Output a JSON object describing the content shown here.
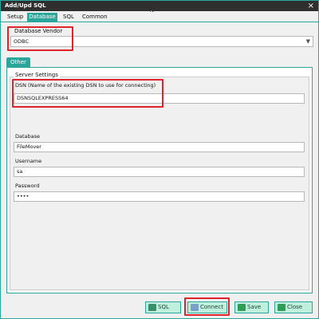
{
  "window": {
    "title": "Add/Upd SQL",
    "close_icon": "×"
  },
  "tabs": [
    {
      "label": "Setup"
    },
    {
      "label": "Database",
      "active": true
    },
    {
      "label": "SQL"
    },
    {
      "label": "Common"
    }
  ],
  "vendor": {
    "group_label": "Database Vendor",
    "selected": "ODBC",
    "dropdown_icon": "chevron-down-icon"
  },
  "subtabs": [
    {
      "label": "Other"
    }
  ],
  "server": {
    "group_label": "Server Settings",
    "dsn_label": "DSN (Name of the existing DSN to use for connecting)",
    "dsn_value": "DSNSQLEXPRESS64",
    "database_label": "Database",
    "database_value": "FileMover",
    "username_label": "Username",
    "username_value": "sa",
    "password_label": "Password",
    "password_value": "••••"
  },
  "footer": {
    "sql_label": "SQL",
    "connect_label": "Connect",
    "save_label": "Save",
    "close_label": "Close"
  },
  "colors": {
    "accent": "#2aa69a",
    "highlight": "#e0242c",
    "titlebar": "#2f2f2f",
    "button_bg": "#bff0de"
  }
}
